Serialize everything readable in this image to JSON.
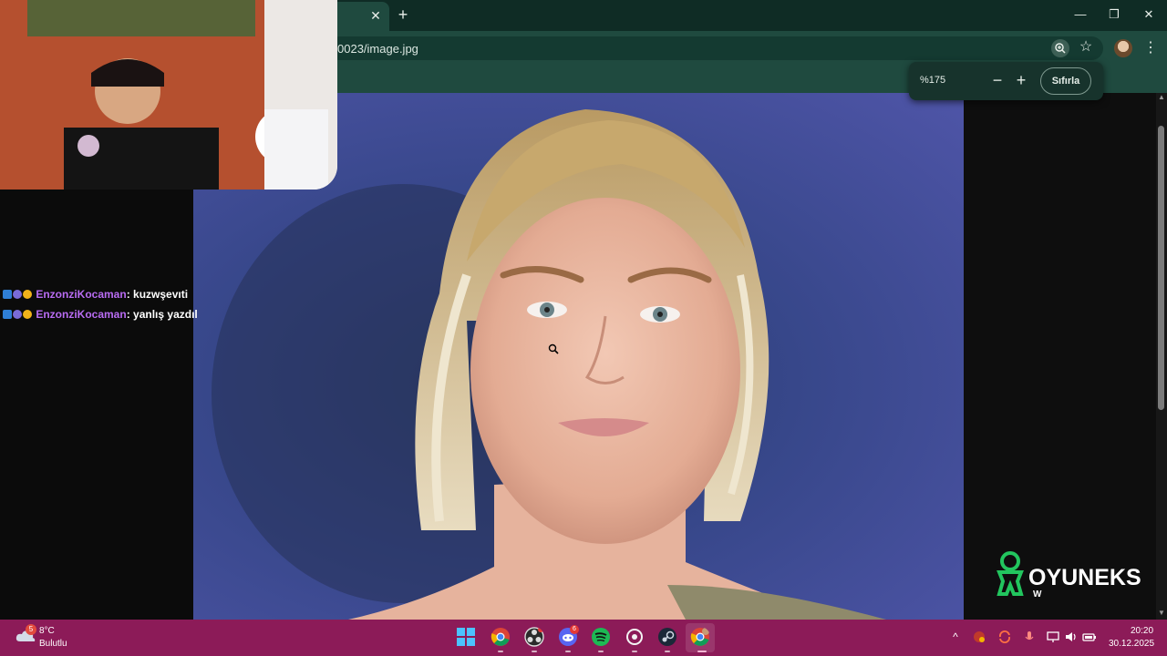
{
  "browser": {
    "tab_close_glyph": "✕",
    "new_tab_glyph": "+",
    "url": "0023/image.jpg",
    "window_controls": {
      "minimize": "—",
      "restore": "❐",
      "close": "✕"
    },
    "menu_glyph": "⋮",
    "star_glyph": "☆"
  },
  "zoom_popup": {
    "level": "%175",
    "minus": "−",
    "plus": "+",
    "reset_label": "Sıfırla"
  },
  "chat": {
    "messages": [
      {
        "user": "EnzonziKocaman",
        "separator": ": ",
        "text": "kuzwşevıti"
      },
      {
        "user": "EnzonziKocaman",
        "separator": ": ",
        "text": "yanlış yazdıl"
      }
    ],
    "badge_colors": [
      "#2f7fd6",
      "#7a6bd8",
      "#f0b21a"
    ],
    "username_color": "#b86cf2"
  },
  "brand": {
    "name": "OYUNEKS",
    "sub": "W",
    "color": "#22c55e"
  },
  "taskbar": {
    "weather": {
      "badge": "5",
      "temperature": "8°C",
      "condition": "Bulutlu"
    },
    "apps": [
      "windows-start-icon",
      "chrome-icon",
      "obs-icon",
      "discord-icon",
      "spotify-icon",
      "steam-client-icon",
      "steam-icon",
      "chrome-profile-icon"
    ],
    "discord_badge": "6",
    "tray": {
      "chevron": "^"
    },
    "clock": {
      "time": "20:20",
      "date": "30.12.2025"
    }
  },
  "colors": {
    "chrome_dark": "#0f2c25",
    "chrome_toolbar": "#1f4a3f",
    "taskbar": "#8c1b58"
  }
}
